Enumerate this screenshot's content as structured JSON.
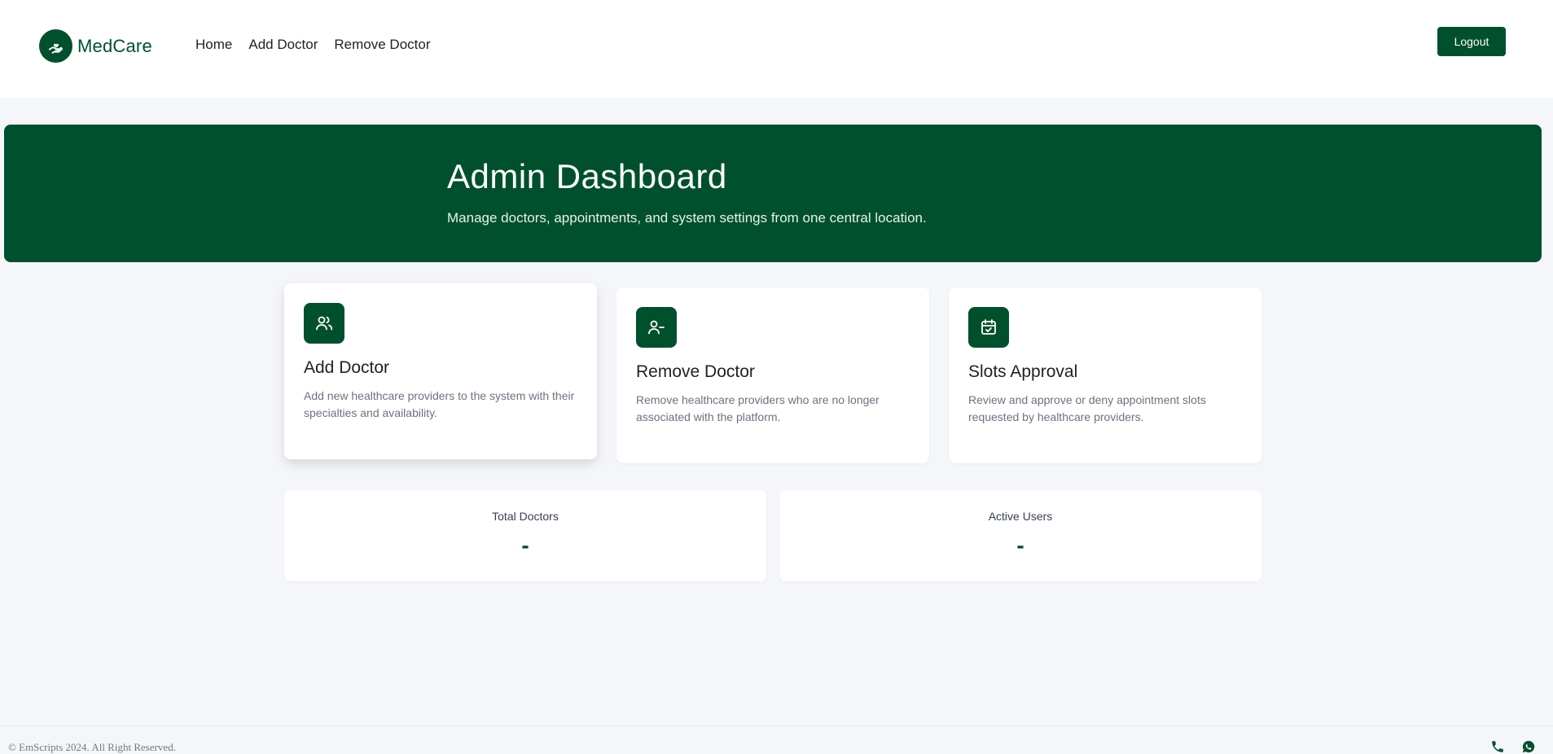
{
  "colors": {
    "brand": "#00502e",
    "background": "#f4f6fa"
  },
  "navbar": {
    "brand_name": "MedCare",
    "brand_icon": "hand-heart-icon",
    "links": [
      {
        "label": "Home"
      },
      {
        "label": "Add Doctor"
      },
      {
        "label": "Remove Doctor"
      }
    ],
    "logout_label": "Logout"
  },
  "hero": {
    "title": "Admin Dashboard",
    "subtitle": "Manage doctors, appointments, and system settings from one central location."
  },
  "cards": [
    {
      "icon": "users-icon",
      "title": "Add Doctor",
      "description": "Add new healthcare providers to the system with their specialties and availability."
    },
    {
      "icon": "user-minus-icon",
      "title": "Remove Doctor",
      "description": "Remove healthcare providers who are no longer associated with the platform."
    },
    {
      "icon": "calendar-check-icon",
      "title": "Slots Approval",
      "description": "Review and approve or deny appointment slots requested by healthcare providers."
    }
  ],
  "stats": [
    {
      "label": "Total Doctors",
      "value": "-"
    },
    {
      "label": "Active Users",
      "value": "-"
    }
  ],
  "footer": {
    "copyright": "© EmScripts 2024. All Right Reserved.",
    "icons": [
      "phone-icon",
      "whatsapp-icon"
    ]
  }
}
